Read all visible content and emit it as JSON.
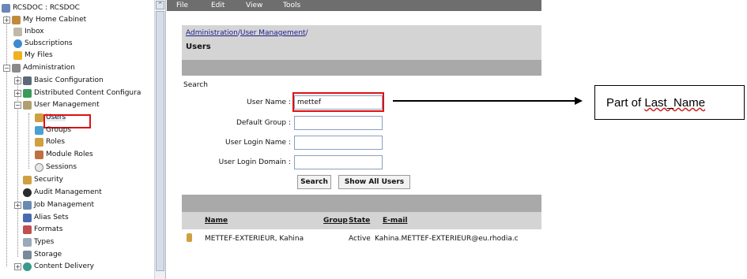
{
  "tree": {
    "items": [
      {
        "label": "RCSDOC : RCSDOC",
        "icon": "repository-icon"
      },
      {
        "label": "My Home Cabinet",
        "icon": "cabinet-icon"
      },
      {
        "label": "Inbox",
        "icon": "inbox-icon"
      },
      {
        "label": "Subscriptions",
        "icon": "subscriptions-icon"
      },
      {
        "label": "My Files",
        "icon": "star-files-icon"
      },
      {
        "label": "Administration",
        "icon": "administration-icon"
      },
      {
        "label": "Basic Configuration",
        "icon": "config-icon"
      },
      {
        "label": "Distributed Content Configura",
        "icon": "distributed-icon"
      },
      {
        "label": "User Management",
        "icon": "user-management-icon"
      },
      {
        "label": "Users",
        "icon": "users-icon"
      },
      {
        "label": "Groups",
        "icon": "groups-icon"
      },
      {
        "label": "Roles",
        "icon": "roles-icon"
      },
      {
        "label": "Module Roles",
        "icon": "module-roles-icon"
      },
      {
        "label": "Sessions",
        "icon": "sessions-icon"
      },
      {
        "label": "Security",
        "icon": "security-icon"
      },
      {
        "label": "Audit Management",
        "icon": "audit-icon"
      },
      {
        "label": "Job Management",
        "icon": "job-icon"
      },
      {
        "label": "Alias Sets",
        "icon": "alias-icon"
      },
      {
        "label": "Formats",
        "icon": "formats-icon"
      },
      {
        "label": "Types",
        "icon": "types-icon"
      },
      {
        "label": "Storage",
        "icon": "storage-icon"
      },
      {
        "label": "Content Delivery",
        "icon": "content-delivery-icon"
      }
    ],
    "scroll_up_glyph": "^"
  },
  "menu": {
    "file": "File",
    "edit": "Edit",
    "view": "View",
    "tools": "Tools"
  },
  "breadcrumb": {
    "part1": "Administration",
    "sep1": "/",
    "part2": "User Management",
    "sep2": "/"
  },
  "page_title": "Users",
  "search": {
    "section_label": "Search",
    "user_name_label": "User Name :",
    "user_name_value": "mettef",
    "default_group_label": "Default Group :",
    "default_group_value": "",
    "login_name_label": "User Login Name :",
    "login_name_value": "",
    "login_domain_label": "User Login Domain :",
    "login_domain_value": "",
    "search_button": "Search",
    "show_all_button": "Show All Users"
  },
  "table": {
    "columns": [
      "Name",
      "Group",
      "State",
      "E-mail"
    ],
    "rows": [
      {
        "name": "METTEF-EXTERIEUR, Kahina",
        "group": "",
        "state": "Active",
        "email": "Kahina.METTEF-EXTERIEUR@eu.rhodia.c"
      }
    ]
  },
  "annotation": {
    "callout_text": "Part of ",
    "callout_squiggle": "Last_Name"
  },
  "colors": {
    "menubar": "#6e6e6e",
    "panel": "#d4d4d4",
    "band": "#a9a9a9",
    "highlight": "#e01010",
    "link": "#1b1b8c"
  }
}
